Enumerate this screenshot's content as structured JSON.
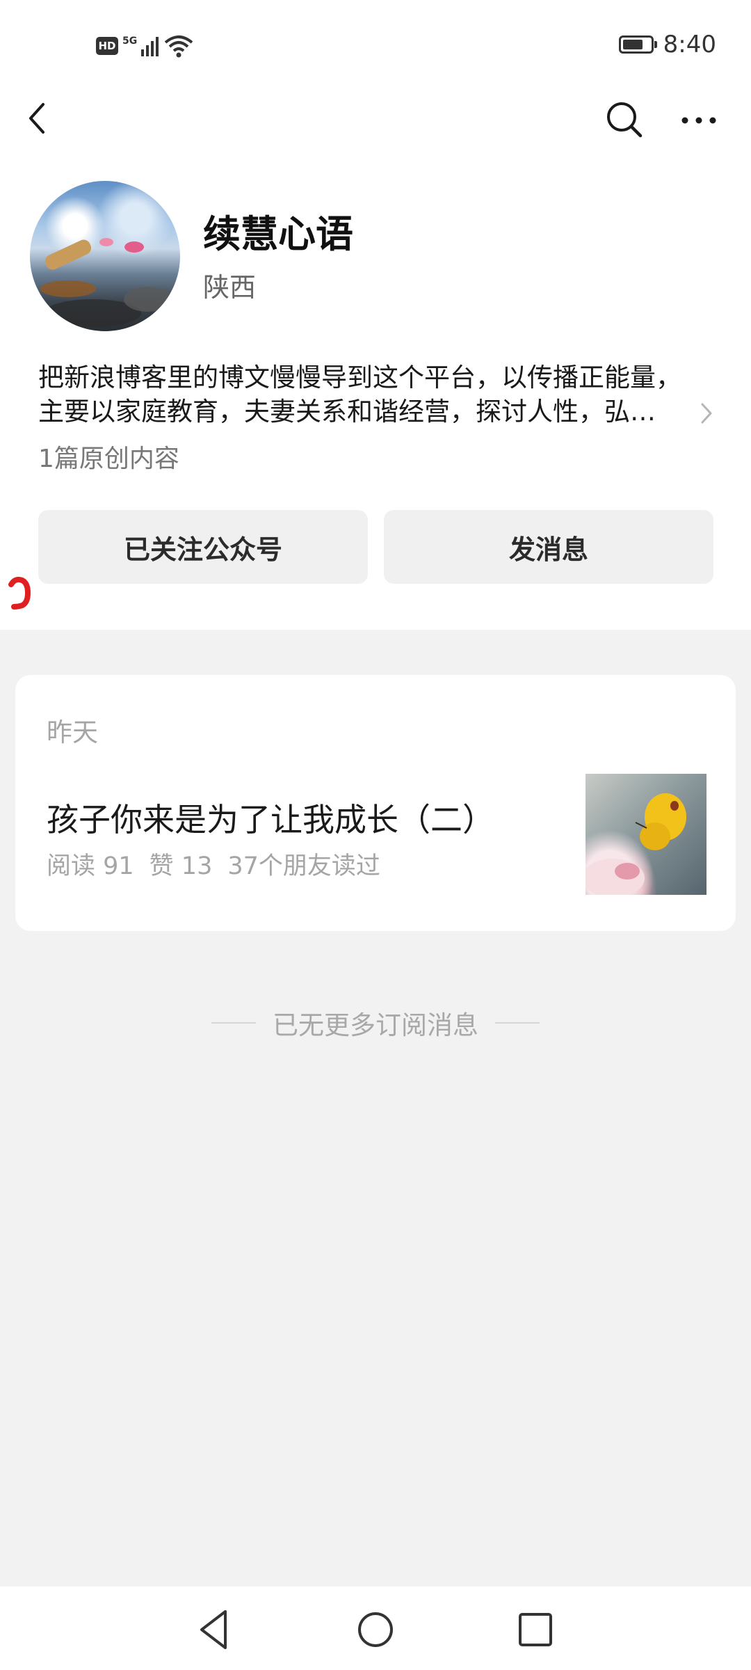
{
  "status_bar": {
    "hd": "HD",
    "network": "5G",
    "time": "8:40",
    "icons": [
      "signal-icon",
      "wifi-icon",
      "battery-icon"
    ]
  },
  "nav": {
    "back_icon": "chevron-left-icon",
    "search_icon": "search-icon",
    "more_icon": "more-horizontal-icon"
  },
  "profile": {
    "name": "续慧心语",
    "region": "陕西",
    "intro_line1": "把新浪博客里的博文慢慢导到这个平台，以传播正能量，",
    "intro_line2": "主要以家庭教育，夫妻关系和谐经营，探讨人性，弘…",
    "original_count": "1篇原创内容"
  },
  "actions": {
    "follow_label": "已关注公众号",
    "message_label": "发消息"
  },
  "articles": [
    {
      "date": "昨天",
      "title": "孩子你来是为了让我成长（二）",
      "reads": "阅读 91",
      "likes": "赞 13",
      "friends_read": "37个朋友读过"
    }
  ],
  "footer": {
    "no_more": "已无更多订阅消息"
  },
  "colors": {
    "background": "#f2f2f2",
    "card": "#ffffff",
    "button_bg": "#f0f0f0",
    "muted_text": "#a5a5a5",
    "annotation_red": "#e02020"
  }
}
